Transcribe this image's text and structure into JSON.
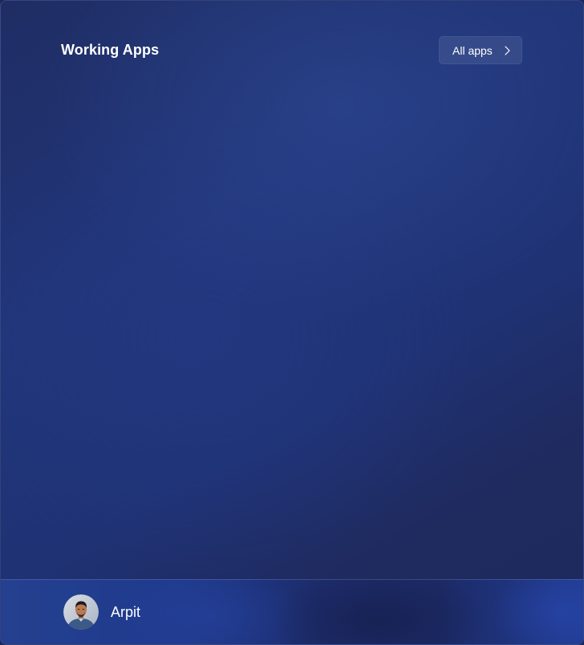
{
  "header": {
    "title": "Working Apps",
    "all_apps_label": "All apps",
    "all_apps_icon": "chevron-right-icon"
  },
  "user": {
    "name": "Arpit",
    "avatar_icon": "avatar"
  },
  "colors": {
    "panel_background": "#213579",
    "footer_background": "#1f3a8c",
    "text": "#ffffff"
  }
}
